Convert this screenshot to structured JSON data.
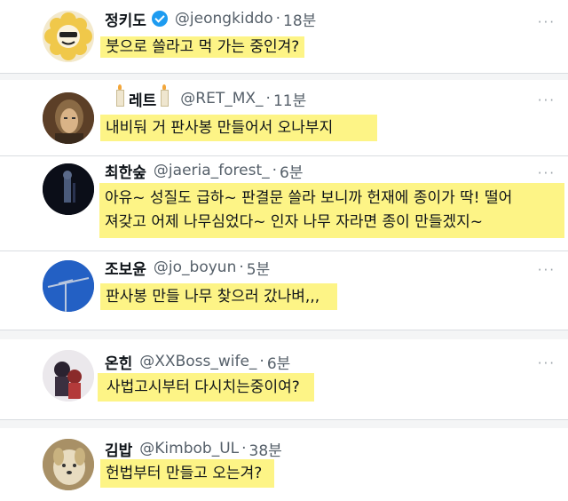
{
  "tweets": [
    {
      "name": "정키도",
      "handle": "@jeongkiddo",
      "separator": "·",
      "time": "18분",
      "verified": true,
      "text": "붓으로 쓸라고 먹 가는 중인겨?",
      "more_icon": "more-dots-icon"
    },
    {
      "name": "레트",
      "handle": "@RET_MX_",
      "separator": "·",
      "time": "11분",
      "text": "내비둬 거 판사봉 만들어서 오나부지",
      "more_icon": "more-dots-icon"
    },
    {
      "name": "최한숲",
      "handle": "@jaeria_forest_",
      "separator": "·",
      "time": "6분",
      "text_line1": "아유~ 성질도 급하~ 판결문 쓸라 보니까 헌재에 종이가 딱! 떨어",
      "text_line2": "져갖고 어제 나무심었다~ 인자 나무 자라면 종이 만들겠지~",
      "more_icon": "more-dots-icon"
    },
    {
      "name": "조보윤",
      "handle": "@jo_boyun",
      "separator": "·",
      "time": "5분",
      "text": "판사봉 만들 나무 찾으러 갔나벼,,,",
      "more_icon": "more-dots-icon"
    },
    {
      "name": "온힌",
      "handle": "@XXBoss_wife_",
      "separator": "·",
      "time": "6분",
      "text": "사법고시부터 다시치는중이여?",
      "more_icon": "more-dots-icon"
    },
    {
      "name": "김밥",
      "handle": "@Kimbob_UL",
      "separator": "·",
      "time": "38분",
      "text": "헌법부터 만들고 오는겨?",
      "more_icon": "more-dots-icon"
    }
  ],
  "colors": {
    "highlight": "#fdf486",
    "verified": "#1d9bf0",
    "muted_text": "#56606a"
  }
}
